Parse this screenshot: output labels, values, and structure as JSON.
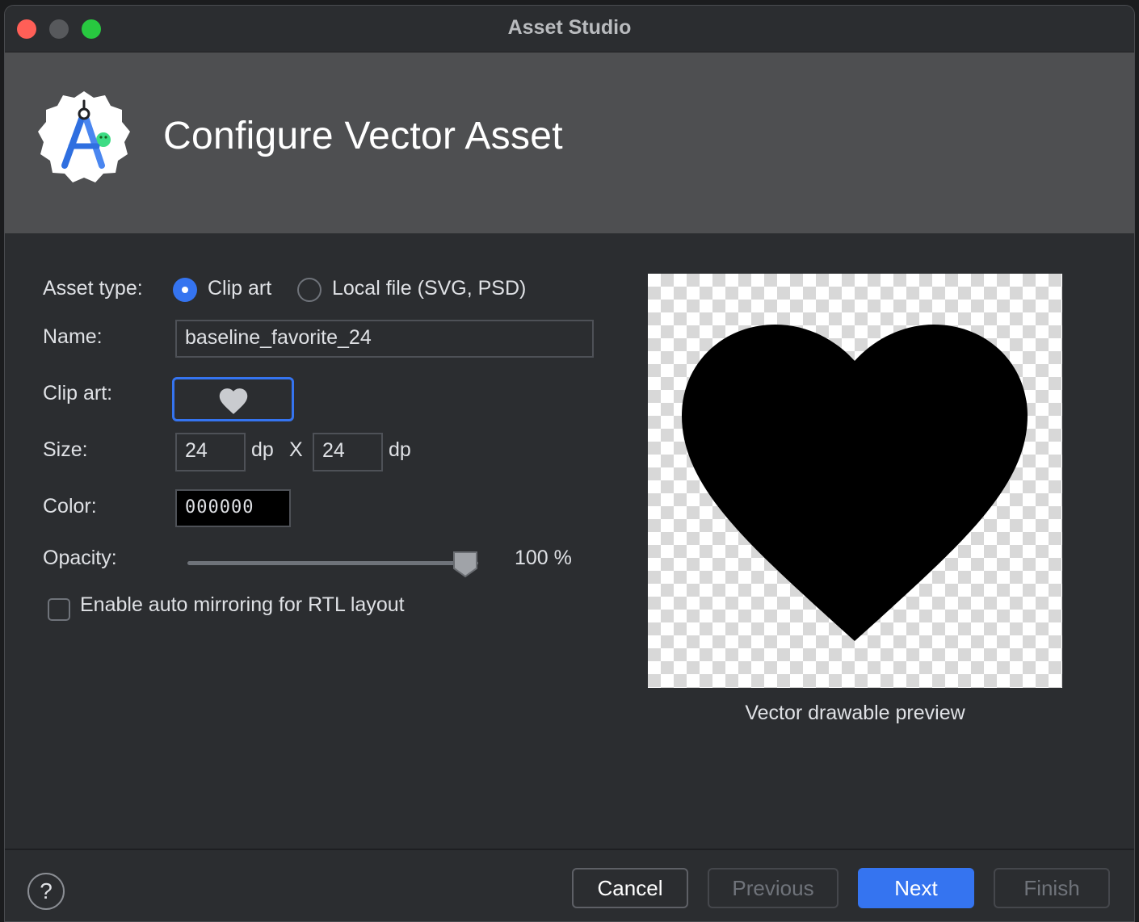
{
  "window": {
    "title": "Asset Studio"
  },
  "banner": {
    "title": "Configure Vector Asset",
    "logo": "android-studio-logo"
  },
  "form": {
    "asset_type_label": "Asset type:",
    "asset_type_options": [
      {
        "label": "Clip art",
        "selected": true
      },
      {
        "label": "Local file (SVG, PSD)",
        "selected": false
      }
    ],
    "name_label": "Name:",
    "name_value": "baseline_favorite_24",
    "clip_art_label": "Clip art:",
    "clip_art_icon": "heart-icon",
    "size_label": "Size:",
    "width_value": "24",
    "width_unit": "dp",
    "size_separator": "X",
    "height_value": "24",
    "height_unit": "dp",
    "color_label": "Color:",
    "color_value": "000000",
    "opacity_label": "Opacity:",
    "opacity_percent": 100,
    "opacity_text": "100 %",
    "rtl_label": "Enable auto mirroring for RTL layout",
    "rtl_checked": false
  },
  "preview": {
    "caption": "Vector drawable preview",
    "icon": "heart-icon",
    "fill": "#000000"
  },
  "footer": {
    "help_label": "?",
    "cancel_label": "Cancel",
    "previous_label": "Previous",
    "next_label": "Next",
    "finish_label": "Finish"
  },
  "colors": {
    "accent": "#3574f0",
    "background": "#2b2d30",
    "banner": "#4e4f51"
  }
}
